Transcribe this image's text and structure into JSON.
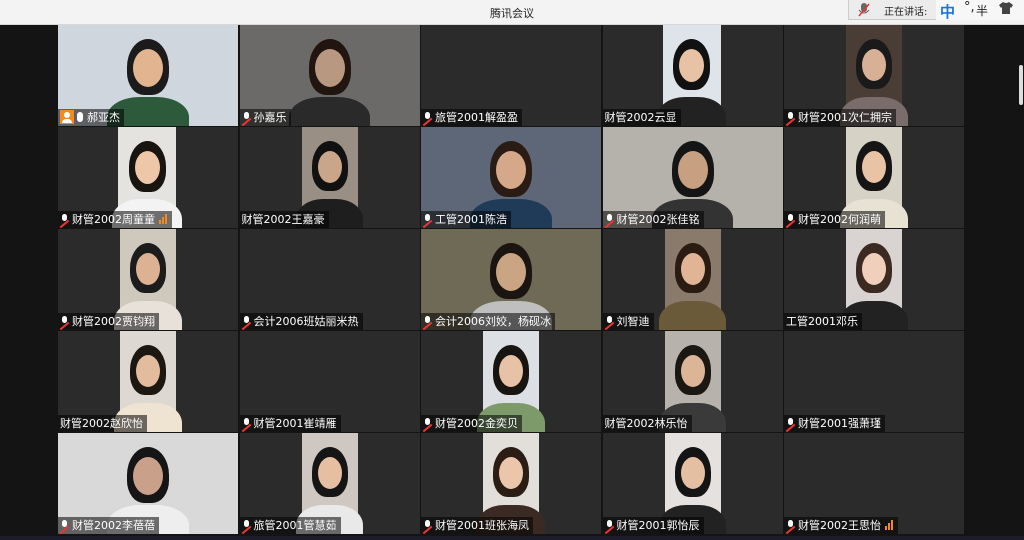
{
  "window": {
    "title": "腾讯会议"
  },
  "speaking": {
    "label": "正在讲话:",
    "mic_icon": "mic-icon"
  },
  "ime": {
    "mode": "中",
    "punct": "°,",
    "width": "半",
    "skin_icon": "shirt-icon"
  },
  "participants": [
    {
      "name": "郝亚杰",
      "icon": "host",
      "mic": "on"
    },
    {
      "name": "孙嘉乐",
      "icon": "mic-muted"
    },
    {
      "name": "旅管2001解盈盈",
      "icon": "mic-muted"
    },
    {
      "name": "财管2002云显",
      "icon": "none"
    },
    {
      "name": "财管2001次仁拥宗",
      "icon": "mic-muted"
    },
    {
      "name": "财管2002周童童",
      "icon": "mic-muted",
      "signal": true
    },
    {
      "name": "财管2002王嘉豪",
      "icon": "none"
    },
    {
      "name": "工管2001陈浩",
      "icon": "mic-muted"
    },
    {
      "name": "财管2002张佳铭",
      "icon": "mic-muted"
    },
    {
      "name": "财管2002何润萌",
      "icon": "mic-muted"
    },
    {
      "name": "财管2002贾钧翔",
      "icon": "mic-muted"
    },
    {
      "name": "会计2006班姑丽米热",
      "icon": "mic-muted"
    },
    {
      "name": "会计2006刘姣，杨砚冰",
      "icon": "mic-muted"
    },
    {
      "name": "刘智迪",
      "icon": "mic-muted"
    },
    {
      "name": "工管2001邓乐",
      "icon": "none"
    },
    {
      "name": "财管2002赵欣怡",
      "icon": "none"
    },
    {
      "name": "财管2001崔靖雁",
      "icon": "mic-muted"
    },
    {
      "name": "财管2002金奕贝",
      "icon": "mic-muted"
    },
    {
      "name": "财管2002林乐怡",
      "icon": "none"
    },
    {
      "name": "财管2001强萧瑾",
      "icon": "mic-muted"
    },
    {
      "name": "财管2002李蓓蓓",
      "icon": "mic-muted"
    },
    {
      "name": "旅管2001管慧茹",
      "icon": "mic-muted"
    },
    {
      "name": "财管2001班张海凤",
      "icon": "mic-muted"
    },
    {
      "name": "财管2001郭怡辰",
      "icon": "mic-muted"
    },
    {
      "name": "财管2002王思怡",
      "icon": "mic-muted",
      "signal": true
    }
  ],
  "colors": {
    "tile_bg": "#2b2b2b",
    "host_badge": "#f28a1e",
    "signal": "#f28a1e",
    "muted": "#e33"
  }
}
